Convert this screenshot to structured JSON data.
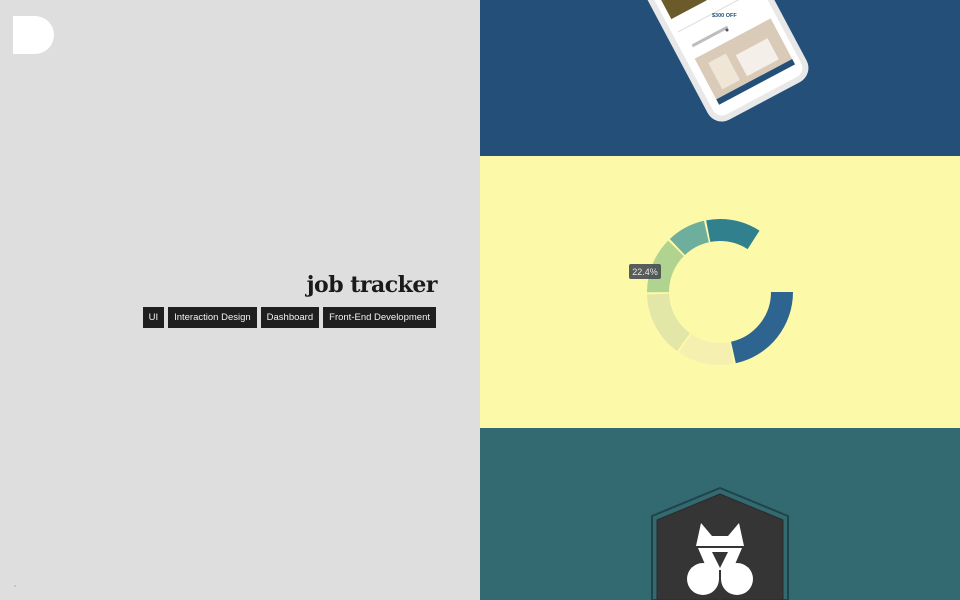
{
  "project": {
    "title": "job tracker",
    "tags": [
      "UI",
      "Interaction Design",
      "Dashboard",
      "Front-End Development"
    ]
  },
  "thumbnails": {
    "phone": {
      "price_text": "$300 OFF",
      "background": "#234f78"
    },
    "donut": {
      "tooltip": "22.4%",
      "background": "#fcf9a9"
    },
    "badge": {
      "background": "#336a71"
    }
  },
  "colors": {
    "left_bg": "#dedede",
    "tag_bg": "#1f1f1f"
  }
}
